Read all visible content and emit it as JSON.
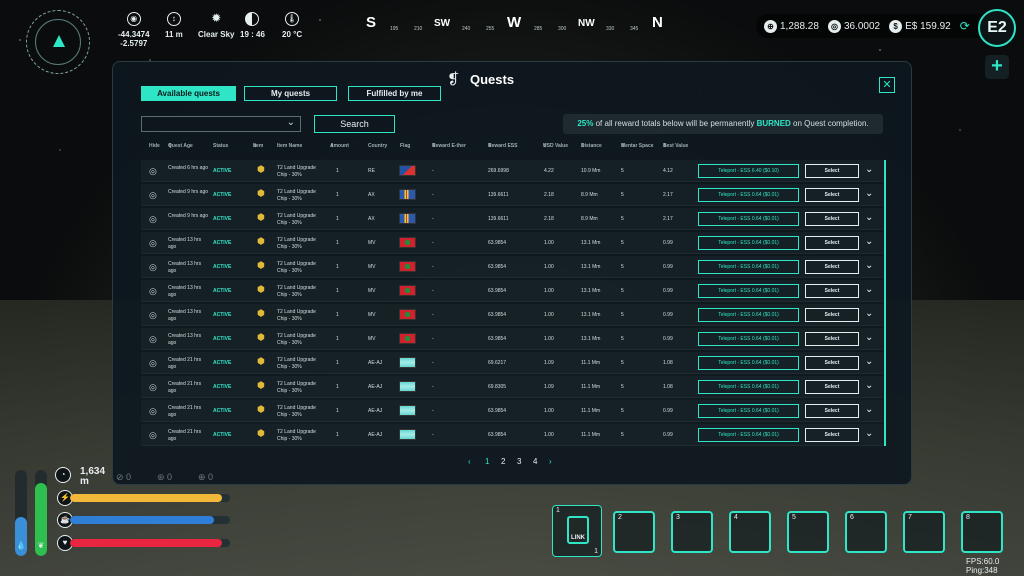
{
  "hud": {
    "coords": [
      "-44.3474",
      "-2.5797"
    ],
    "altitude": "11 m",
    "weather": "Clear Sky",
    "time": "19 : 46",
    "temperature": "20 °C",
    "icons": [
      "compass-target-icon",
      "altitude-icon",
      "sun-icon",
      "moon-phase-icon",
      "thermometer-icon"
    ]
  },
  "compass": {
    "labels": [
      "S",
      "195",
      "210",
      "SW",
      "240",
      "255",
      "W",
      "285",
      "300",
      "NW",
      "330",
      "345",
      "N"
    ]
  },
  "wallet": {
    "balance_1": "1,288.28",
    "balance_2": "36.0002",
    "balance_3": "E$ 159.92"
  },
  "panel": {
    "title": "Quests",
    "tabs": [
      "Available quests",
      "My quests",
      "Fulfilled by me"
    ],
    "active_tab": 0,
    "search_label": "Search",
    "burn_pct": "25%",
    "burn_text_1": "of all reward totals below will be permanently",
    "burn_word": "BURNED",
    "burn_text_2": "on Quest completion.",
    "columns": [
      "Hide",
      "Quest Age",
      "Status",
      "Item",
      "Item Name",
      "Amount",
      "Country",
      "Flag",
      "Reward E-ther",
      "Reward ESS",
      "USD Value",
      "Distance",
      "Mentar Space",
      "Best Value"
    ],
    "rows": [
      {
        "age": "Created 6 hrs ago",
        "status": "ACTIVE",
        "name": "T2 Land Upgrade Chip - 30%",
        "amount": "1",
        "country": "RE",
        "flag": "flag-re",
        "ether": "-",
        "ess": "269.6998",
        "usd": "4.22",
        "dist": "10.9 Mm",
        "space": "5",
        "best": "4.12",
        "teleport": "Teleport - ESS 6.40 ($0.10)",
        "select": "Select"
      },
      {
        "age": "Created 9 hrs ago",
        "status": "ACTIVE",
        "name": "T2 Land Upgrade Chip - 30%",
        "amount": "1",
        "country": "AX",
        "flag": "flag-ax",
        "ether": "-",
        "ess": "139.6611",
        "usd": "2.18",
        "dist": "8.9 Mm",
        "space": "5",
        "best": "2.17",
        "teleport": "Teleport - ESS 0.64 ($0.01)",
        "select": "Select"
      },
      {
        "age": "Created 9 hrs ago",
        "status": "ACTIVE",
        "name": "T2 Land Upgrade Chip - 30%",
        "amount": "1",
        "country": "AX",
        "flag": "flag-ax",
        "ether": "-",
        "ess": "139.6611",
        "usd": "2.18",
        "dist": "8.9 Mm",
        "space": "5",
        "best": "2.17",
        "teleport": "Teleport - ESS 0.64 ($0.01)",
        "select": "Select"
      },
      {
        "age": "Created 13 hrs ago",
        "status": "ACTIVE",
        "name": "T2 Land Upgrade Chip - 30%",
        "amount": "1",
        "country": "MV",
        "flag": "flag-mv",
        "ether": "-",
        "ess": "63.9854",
        "usd": "1.00",
        "dist": "13.1 Mm",
        "space": "5",
        "best": "0.99",
        "teleport": "Teleport - ESS 0.64 ($0.01)",
        "select": "Select"
      },
      {
        "age": "Created 13 hrs ago",
        "status": "ACTIVE",
        "name": "T2 Land Upgrade Chip - 30%",
        "amount": "1",
        "country": "MV",
        "flag": "flag-mv",
        "ether": "-",
        "ess": "63.9854",
        "usd": "1.00",
        "dist": "13.1 Mm",
        "space": "5",
        "best": "0.99",
        "teleport": "Teleport - ESS 0.64 ($0.01)",
        "select": "Select"
      },
      {
        "age": "Created 13 hrs ago",
        "status": "ACTIVE",
        "name": "T2 Land Upgrade Chip - 30%",
        "amount": "1",
        "country": "MV",
        "flag": "flag-mv",
        "ether": "-",
        "ess": "63.9854",
        "usd": "1.00",
        "dist": "13.1 Mm",
        "space": "5",
        "best": "0.99",
        "teleport": "Teleport - ESS 0.64 ($0.01)",
        "select": "Select"
      },
      {
        "age": "Created 13 hrs ago",
        "status": "ACTIVE",
        "name": "T2 Land Upgrade Chip - 30%",
        "amount": "1",
        "country": "MV",
        "flag": "flag-mv",
        "ether": "-",
        "ess": "63.9854",
        "usd": "1.00",
        "dist": "13.1 Mm",
        "space": "5",
        "best": "0.99",
        "teleport": "Teleport - ESS 0.64 ($0.01)",
        "select": "Select"
      },
      {
        "age": "Created 13 hrs ago",
        "status": "ACTIVE",
        "name": "T2 Land Upgrade Chip - 30%",
        "amount": "1",
        "country": "MV",
        "flag": "flag-mv",
        "ether": "-",
        "ess": "63.9854",
        "usd": "1.00",
        "dist": "13.1 Mm",
        "space": "5",
        "best": "0.99",
        "teleport": "Teleport - ESS 0.64 ($0.01)",
        "select": "Select"
      },
      {
        "age": "Created 21 hrs ago",
        "status": "ACTIVE",
        "name": "T2 Land Upgrade Chip - 30%",
        "amount": "1",
        "country": "AE-AJ",
        "flag": "flag-ae-aj",
        "ether": "-",
        "ess": "69.6217",
        "usd": "1.09",
        "dist": "11.1 Mm",
        "space": "5",
        "best": "1.08",
        "teleport": "Teleport - ESS 0.64 ($0.01)",
        "select": "Select"
      },
      {
        "age": "Created 21 hrs ago",
        "status": "ACTIVE",
        "name": "T2 Land Upgrade Chip - 30%",
        "amount": "1",
        "country": "AE-AJ",
        "flag": "flag-ae-aj",
        "ether": "-",
        "ess": "69.8305",
        "usd": "1.09",
        "dist": "11.1 Mm",
        "space": "5",
        "best": "1.08",
        "teleport": "Teleport - ESS 0.64 ($0.01)",
        "select": "Select"
      },
      {
        "age": "Created 21 hrs ago",
        "status": "ACTIVE",
        "name": "T2 Land Upgrade Chip - 30%",
        "amount": "1",
        "country": "AE-AJ",
        "flag": "flag-ae-aj",
        "ether": "-",
        "ess": "63.9854",
        "usd": "1.00",
        "dist": "11.1 Mm",
        "space": "5",
        "best": "0.99",
        "teleport": "Teleport - ESS 0.64 ($0.01)",
        "select": "Select"
      },
      {
        "age": "Created 21 hrs ago",
        "status": "ACTIVE",
        "name": "T2 Land Upgrade Chip - 30%",
        "amount": "1",
        "country": "AE-AJ",
        "flag": "flag-ae-aj",
        "ether": "-",
        "ess": "63.9854",
        "usd": "1.00",
        "dist": "11.1 Mm",
        "space": "5",
        "best": "0.99",
        "teleport": "Teleport - ESS 0.64 ($0.01)",
        "select": "Select"
      }
    ],
    "pages": [
      "1",
      "2",
      "3",
      "4"
    ],
    "current_page": "1"
  },
  "vitals": {
    "altitude_value": "1,634",
    "altitude_unit": "m",
    "stat_a": "0",
    "stat_b": "0",
    "stat_c": "0",
    "energy_level": 0.95,
    "hydration_level": 0.9,
    "health_level": 0.95,
    "water_level": 0.45,
    "stamina_level": 0.85,
    "colors": {
      "energy": "#f1b83a",
      "hydration": "#2f7fd6",
      "health": "#e9253f",
      "water": "#3a8fd6",
      "stamina": "#2fbf4e"
    }
  },
  "hotbar": {
    "slots": [
      "1",
      "2",
      "3",
      "4",
      "5",
      "6",
      "7",
      "8"
    ],
    "first_item_label": "LINK",
    "first_item_count": "1"
  },
  "perf": {
    "fps": "FPS:60.0",
    "ping": "Ping:348"
  },
  "accent": "#2ee6c5"
}
